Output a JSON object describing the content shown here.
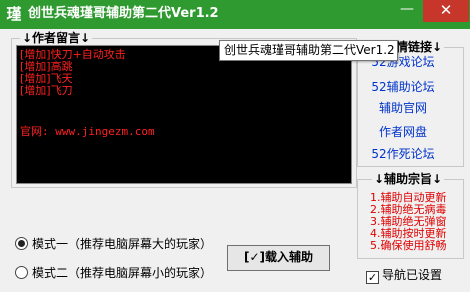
{
  "window": {
    "title": "创世兵魂瑾哥辅助第二代Ver1.2",
    "icon_glyph": "瑾",
    "minimize_glyph": "—",
    "close_glyph": "✕",
    "titlebar_color": "#2f9a2f",
    "close_color": "#c7362a"
  },
  "tooltip": "创世兵魂瑾哥辅助第二代Ver1.2",
  "notes": {
    "legend": "↓作者留言↓",
    "lines": [
      "[增加]快刀+自动攻击",
      "[增加]高跳",
      "[增加]飞天",
      "[增加]飞刀"
    ],
    "url_line": "官网: www.jingezm.com",
    "text_color": "#ff2020"
  },
  "links": {
    "legend": "↓友情链接↓",
    "items": [
      "52游戏论坛",
      "52辅助论坛",
      "辅助官网",
      "作者网盘",
      "52作死论坛"
    ],
    "color": "#0033cc"
  },
  "purpose": {
    "legend": "↓辅助宗旨↓",
    "items": [
      "1.辅助自动更新",
      "2.辅助绝无病毒",
      "3.辅助绝无弹窗",
      "4.辅助按时更新",
      "5.确保使用舒畅"
    ],
    "color": "#e00000"
  },
  "modes": {
    "mode1": "模式一（推荐电脑屏幕大的玩家）",
    "mode2": "模式二（推荐电脑屏幕小的玩家）",
    "selected": "mode1"
  },
  "load_button": "[✓]载入辅助",
  "nav_checkbox": {
    "label": "导航已设置",
    "checked": true
  }
}
